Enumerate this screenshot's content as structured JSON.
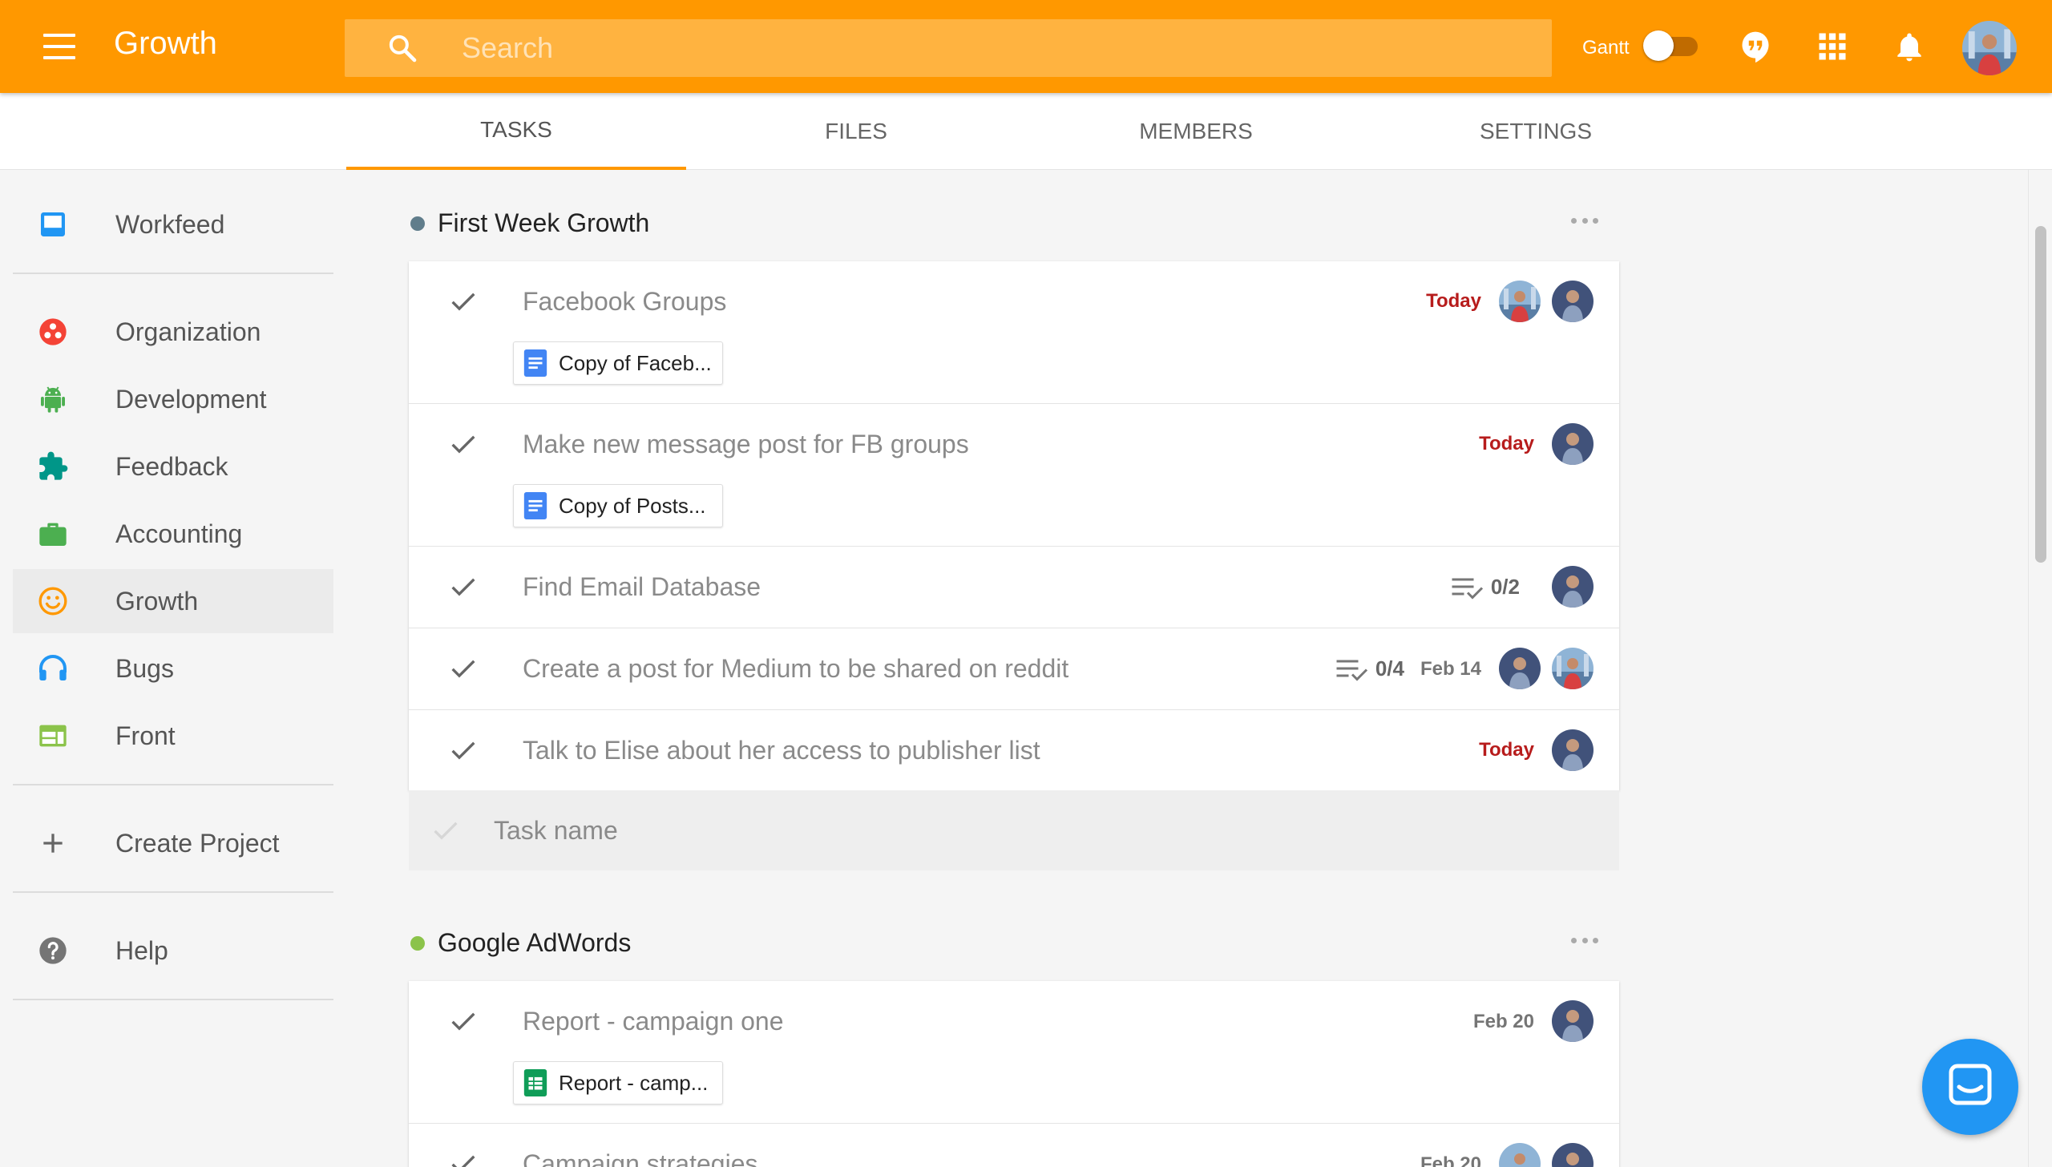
{
  "header": {
    "app_title": "Growth",
    "search_placeholder": "Search",
    "gantt_label": "Gantt",
    "gantt_enabled": false,
    "accent_color": "#ff9800"
  },
  "tabs": [
    {
      "label": "TASKS",
      "active": true
    },
    {
      "label": "FILES",
      "active": false
    },
    {
      "label": "MEMBERS",
      "active": false
    },
    {
      "label": "SETTINGS",
      "active": false
    }
  ],
  "sidebar": {
    "items": [
      {
        "label": "Workfeed",
        "icon": "inbox-icon",
        "color": "#2196f3"
      },
      {
        "label": "Organization",
        "icon": "organization-icon",
        "color": "#f44336"
      },
      {
        "label": "Development",
        "icon": "android-icon",
        "color": "#4caf50"
      },
      {
        "label": "Feedback",
        "icon": "puzzle-icon",
        "color": "#009688"
      },
      {
        "label": "Accounting",
        "icon": "briefcase-icon",
        "color": "#4caf50"
      },
      {
        "label": "Growth",
        "icon": "smiley-icon",
        "color": "#ff9800",
        "active": true
      },
      {
        "label": "Bugs",
        "icon": "headset-icon",
        "color": "#2196f3"
      },
      {
        "label": "Front",
        "icon": "web-icon",
        "color": "#8bc34a"
      },
      {
        "label": "Create Project",
        "icon": "plus-icon",
        "color": "#666666"
      },
      {
        "label": "Help",
        "icon": "help-icon",
        "color": "#757575"
      }
    ]
  },
  "groups": [
    {
      "title": "First Week Growth",
      "dot_color": "#607d8b",
      "tasks": [
        {
          "name": "Facebook Groups",
          "due": "Today",
          "attachment": "Copy of Faceb..."
        },
        {
          "name": "Make new message post for FB groups",
          "due": "Today",
          "attachment": "Copy of Posts..."
        },
        {
          "name": "Find Email Database",
          "subtasks": "0/2"
        },
        {
          "name": "Create a post for Medium to be shared on reddit",
          "subtasks": "0/4",
          "due": "Feb 14"
        },
        {
          "name": "Talk to Elise about her access to publisher list",
          "due": "Today"
        }
      ],
      "new_task_placeholder": "Task name"
    },
    {
      "title": "Google AdWords",
      "dot_color": "#8bc34a",
      "tasks": [
        {
          "name": "Report - campaign one",
          "due": "Feb 20",
          "attachment": "Report - camp..."
        },
        {
          "name": "Campaign strategies",
          "due": "Feb 20"
        }
      ]
    }
  ]
}
